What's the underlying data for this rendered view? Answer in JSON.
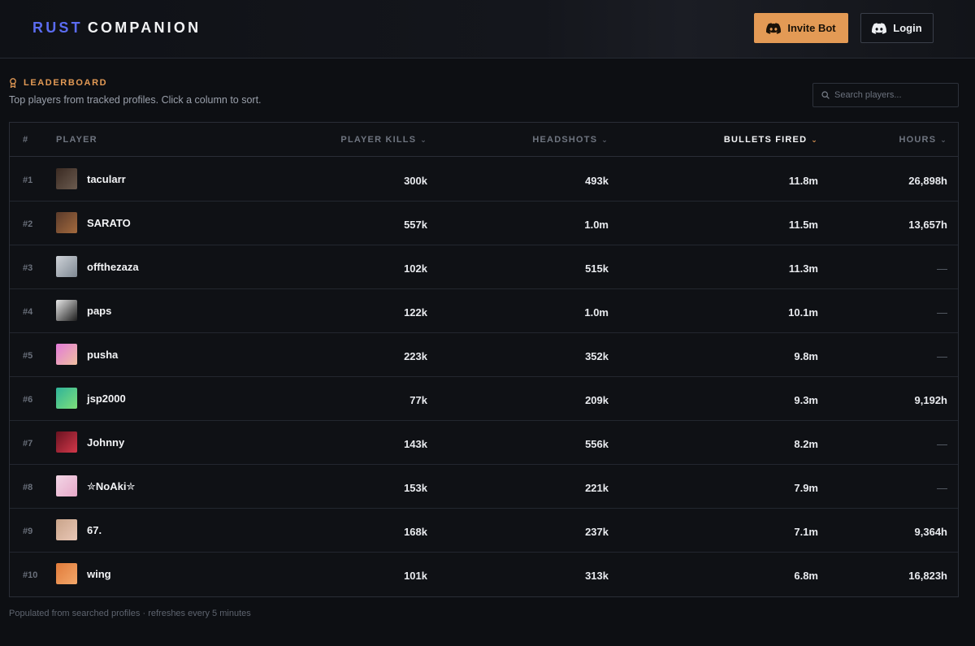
{
  "brand": {
    "part1": "RUST",
    "part2": "COMPANION"
  },
  "header": {
    "invite_label": "Invite Bot",
    "login_label": "Login",
    "invite_color": "#e39a55"
  },
  "leaderboard": {
    "title": "LEADERBOARD",
    "subtitle": "Top players from tracked profiles. Click a column to sort.",
    "search_placeholder": "Search players...",
    "columns": {
      "rank": "#",
      "player": "PLAYER",
      "kills": "PLAYER KILLS",
      "headshots": "HEADSHOTS",
      "bullets": "BULLETS FIRED",
      "hours": "HOURS"
    },
    "sorted_by": "bullets",
    "rows": [
      {
        "rank": "#1",
        "name": "tacularr",
        "kills": "300k",
        "headshots": "493k",
        "bullets": "11.8m",
        "hours": "26,898h",
        "avatar_colors": [
          "#3a2a22",
          "#6b5b4f"
        ]
      },
      {
        "rank": "#2",
        "name": "SARATO",
        "kills": "557k",
        "headshots": "1.0m",
        "bullets": "11.5m",
        "hours": "13,657h",
        "avatar_colors": [
          "#5a3a2a",
          "#a36a3e"
        ]
      },
      {
        "rank": "#3",
        "name": "offthezaza",
        "kills": "102k",
        "headshots": "515k",
        "bullets": "11.3m",
        "hours": "—",
        "avatar_colors": [
          "#cfd3d8",
          "#7e8893"
        ]
      },
      {
        "rank": "#4",
        "name": "paps",
        "kills": "122k",
        "headshots": "1.0m",
        "bullets": "10.1m",
        "hours": "—",
        "avatar_colors": [
          "#e8e8e8",
          "#1c1c1c"
        ]
      },
      {
        "rank": "#5",
        "name": "pusha",
        "kills": "223k",
        "headshots": "352k",
        "bullets": "9.8m",
        "hours": "—",
        "avatar_colors": [
          "#e27ad8",
          "#f0c0a0"
        ]
      },
      {
        "rank": "#6",
        "name": "jsp2000",
        "kills": "77k",
        "headshots": "209k",
        "bullets": "9.3m",
        "hours": "9,192h",
        "avatar_colors": [
          "#2fb39a",
          "#7fe07a"
        ]
      },
      {
        "rank": "#7",
        "name": "Johnny",
        "kills": "143k",
        "headshots": "556k",
        "bullets": "8.2m",
        "hours": "—",
        "avatar_colors": [
          "#6a1220",
          "#d2384a"
        ]
      },
      {
        "rank": "#8",
        "name": "✮NoAki✮",
        "kills": "153k",
        "headshots": "221k",
        "bullets": "7.9m",
        "hours": "—",
        "avatar_colors": [
          "#f3d6e6",
          "#e6a8c8"
        ]
      },
      {
        "rank": "#9",
        "name": "67.",
        "kills": "168k",
        "headshots": "237k",
        "bullets": "7.1m",
        "hours": "9,364h",
        "avatar_colors": [
          "#c9a48a",
          "#e9c7b6"
        ]
      },
      {
        "rank": "#10",
        "name": "wing",
        "kills": "101k",
        "headshots": "313k",
        "bullets": "6.8m",
        "hours": "16,823h",
        "avatar_colors": [
          "#e07a3a",
          "#f3a86a"
        ]
      }
    ],
    "footer": "Populated from searched profiles · refreshes every 5 minutes"
  }
}
